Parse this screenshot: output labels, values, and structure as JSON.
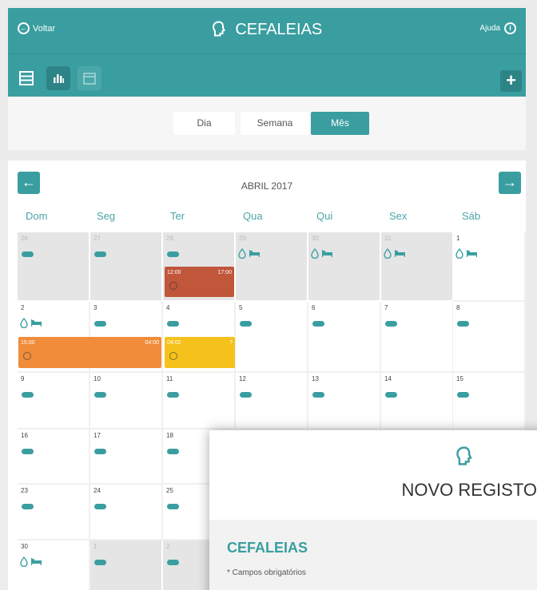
{
  "header": {
    "back_label": "Voltar",
    "title": "CEFALEIAS",
    "help_label": "Ajuda",
    "add_label": "+"
  },
  "view_tabs": [
    "Dia",
    "Semana",
    "Mês"
  ],
  "selected_tab": "Mês",
  "calendar": {
    "month_label": "ABRIL 2017",
    "weekdays": [
      "Dom",
      "Seg",
      "Ter",
      "Qua",
      "Qui",
      "Sex",
      "Sáb"
    ],
    "weeks": [
      [
        "26",
        "27",
        "28",
        "29",
        "30",
        "31",
        "1"
      ],
      [
        "2",
        "3",
        "4",
        "5",
        "6",
        "7",
        "8"
      ],
      [
        "9",
        "10",
        "11",
        "12",
        "13",
        "14",
        "15"
      ],
      [
        "16",
        "17",
        "18",
        "",
        "",
        "",
        ""
      ],
      [
        "23",
        "24",
        "25",
        "",
        "",
        "",
        ""
      ],
      [
        "30",
        "1",
        "2",
        "",
        "",
        "",
        ""
      ]
    ],
    "events": [
      {
        "start": "12:00",
        "end": "17:00",
        "color": "#c0563a"
      },
      {
        "start": "15:00",
        "end": "04:00",
        "color": "#f08c3a"
      },
      {
        "start": "04:02",
        "end": "?",
        "color": "#f5c21b"
      }
    ]
  },
  "modal": {
    "title": "NOVO REGISTO",
    "section": "CEFALEIAS",
    "required_note": "* Campos obrigatórios"
  },
  "colors": {
    "accent": "#3a9ea0",
    "accent_dark": "#2d8486",
    "other_month": "#e5e5e5"
  },
  "icons": [
    "back-arrow-icon",
    "head-icon",
    "info-icon",
    "list-view-icon",
    "chart-icon",
    "calendar-icon",
    "plus-icon",
    "pill-icon",
    "drop-icon",
    "bed-icon",
    "arrow-left-icon",
    "arrow-right-icon"
  ]
}
